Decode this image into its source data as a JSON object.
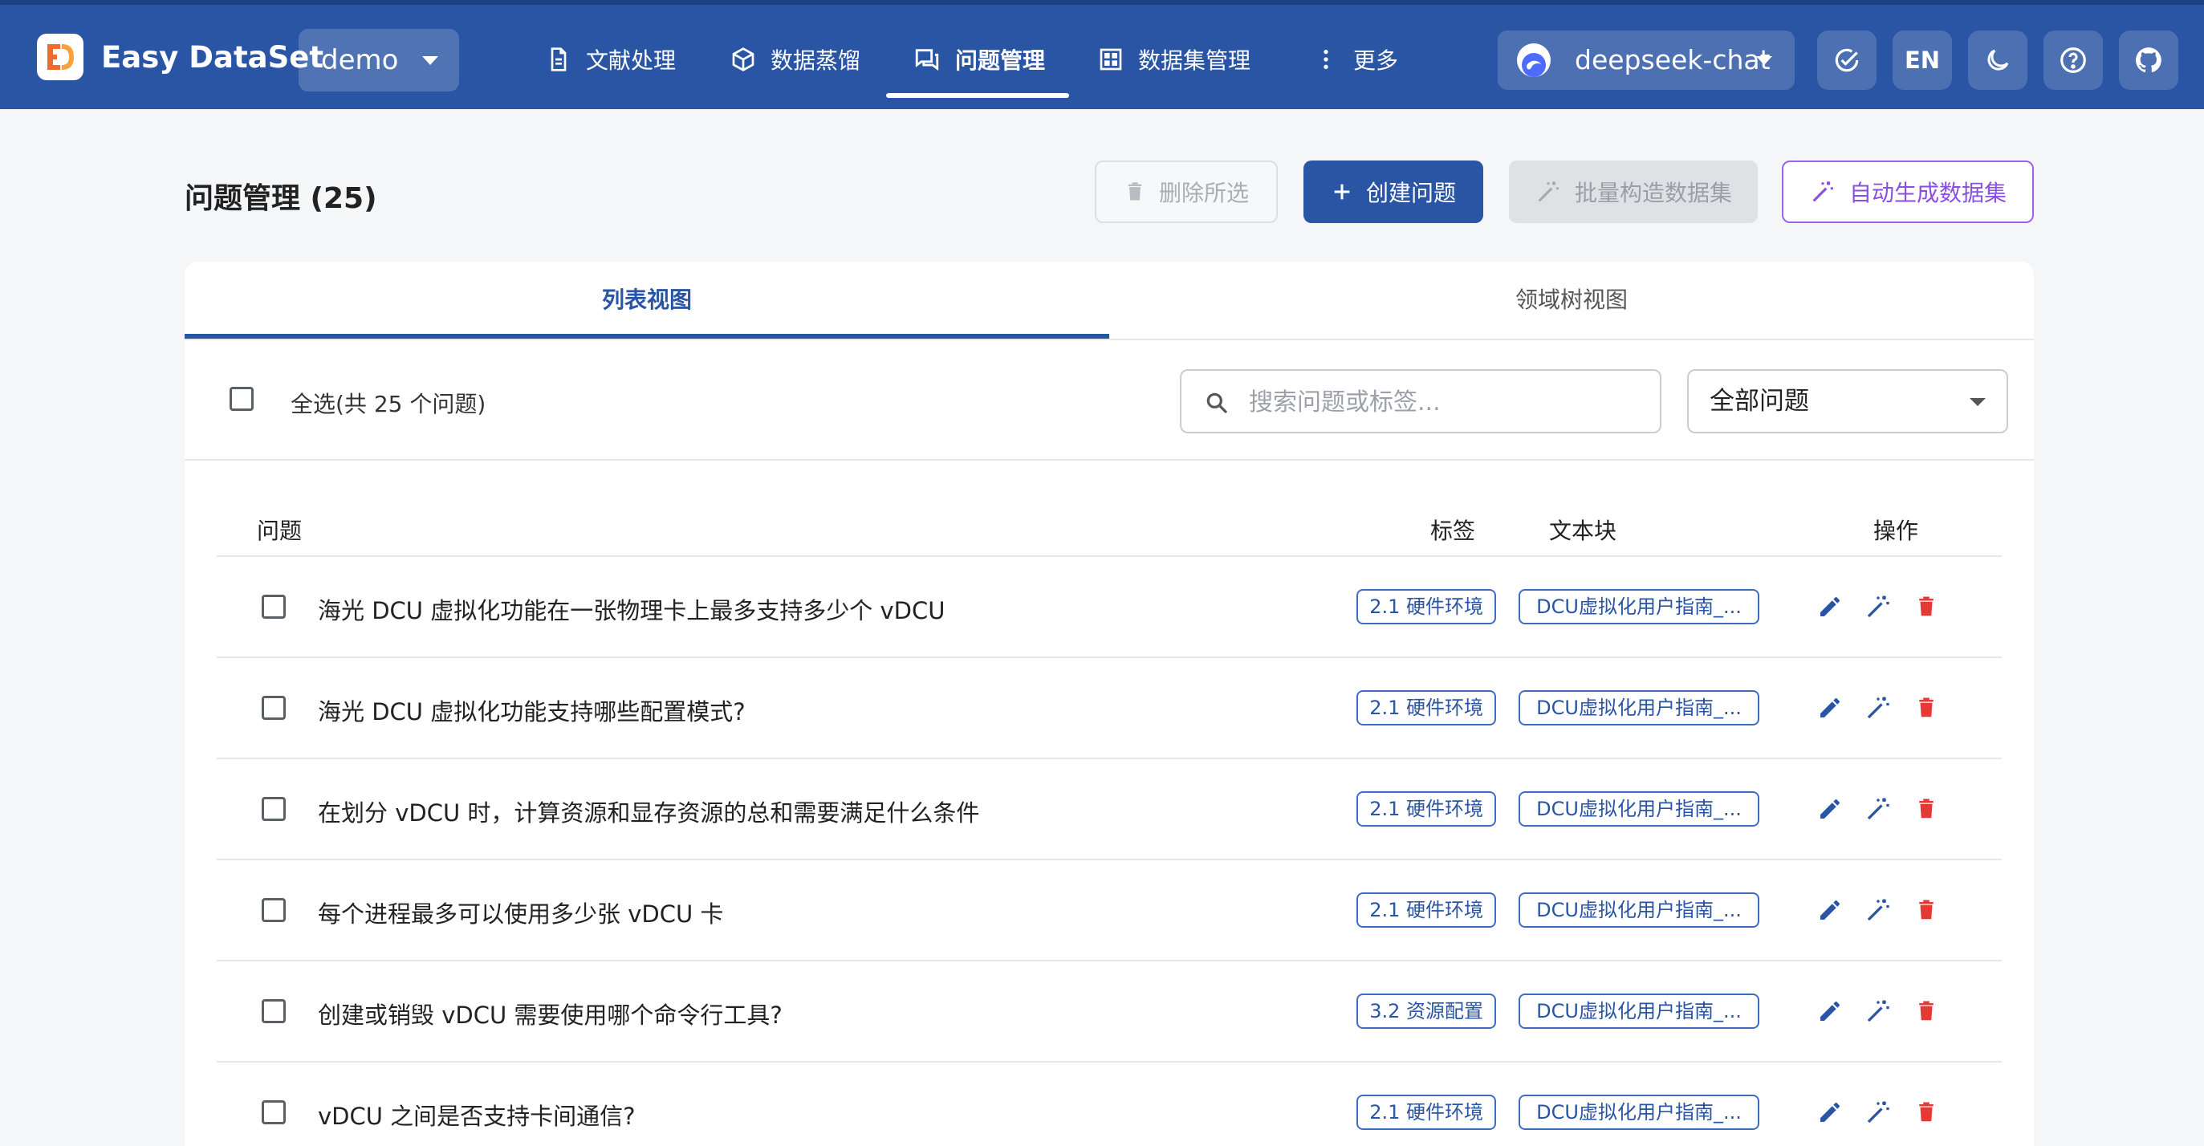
{
  "app": {
    "name": "Easy DataSet",
    "project": "demo"
  },
  "nav": {
    "items": [
      {
        "label": "文献处理",
        "icon": "document-icon"
      },
      {
        "label": "数据蒸馏",
        "icon": "cube-icon"
      },
      {
        "label": "问题管理",
        "icon": "chat-bubbles-icon",
        "active": true
      },
      {
        "label": "数据集管理",
        "icon": "grid-icon"
      },
      {
        "label": "更多",
        "icon": "more-vertical-icon"
      }
    ]
  },
  "header_right": {
    "model": "deepseek-chat",
    "lang": "EN",
    "icons": [
      "check-circle-icon",
      "moon-icon",
      "help-icon",
      "github-icon"
    ]
  },
  "page": {
    "title": "问题管理 (25)",
    "buttons": {
      "delete_selected": "删除所选",
      "create": "创建问题",
      "batch_build": "批量构造数据集",
      "auto_generate": "自动生成数据集"
    }
  },
  "tabs": [
    {
      "label": "列表视图",
      "active": true
    },
    {
      "label": "领域树视图",
      "active": false
    }
  ],
  "toolbar": {
    "select_all": "全选(共 25 个问题)",
    "search_placeholder": "搜索问题或标签...",
    "filter": "全部问题"
  },
  "table": {
    "headers": {
      "question": "问题",
      "tag": "标签",
      "chunk": "文本块",
      "actions": "操作"
    },
    "rows": [
      {
        "question": "海光 DCU 虚拟化功能在一张物理卡上最多支持多少个 vDCU",
        "tag": "2.1 硬件环境",
        "chunk": "DCU虚拟化用户指南_..."
      },
      {
        "question": "海光 DCU 虚拟化功能支持哪些配置模式?",
        "tag": "2.1 硬件环境",
        "chunk": "DCU虚拟化用户指南_..."
      },
      {
        "question": "在划分 vDCU 时，计算资源和显存资源的总和需要满足什么条件",
        "tag": "2.1 硬件环境",
        "chunk": "DCU虚拟化用户指南_..."
      },
      {
        "question": "每个进程最多可以使用多少张 vDCU 卡",
        "tag": "2.1 硬件环境",
        "chunk": "DCU虚拟化用户指南_..."
      },
      {
        "question": "创建或销毁 vDCU 需要使用哪个命令行工具?",
        "tag": "3.2 资源配置",
        "chunk": "DCU虚拟化用户指南_..."
      },
      {
        "question": "vDCU 之间是否支持卡间通信?",
        "tag": "2.1 硬件环境",
        "chunk": "DCU虚拟化用户指南_..."
      }
    ]
  },
  "colors": {
    "brand": "#2a55a4",
    "accent_purple": "#8a4fe0",
    "danger": "#e53935",
    "logo_orange": "#f26b2b"
  }
}
